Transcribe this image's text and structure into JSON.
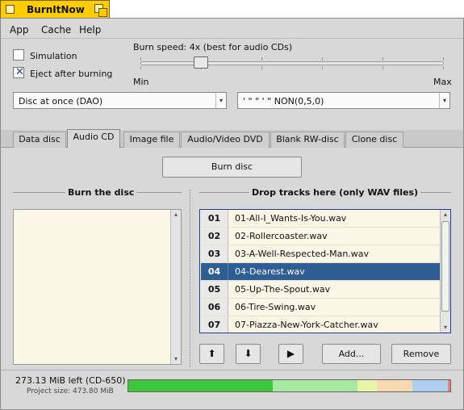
{
  "app": {
    "title": "BurnItNow"
  },
  "menubar": {
    "items": [
      "App",
      "Cache",
      "Help"
    ]
  },
  "options": {
    "simulation_label": "Simulation",
    "simulation_checked": false,
    "eject_label": "Eject after burning",
    "eject_checked": true
  },
  "speed": {
    "label": "Burn speed: 4x (best for audio CDs)",
    "min_label": "Min",
    "max_label": "Max",
    "level": 0.2
  },
  "mode_select": {
    "value": "Disc at once (DAO)"
  },
  "device_select": {
    "value": "' \" \" ' \" NON(0,5,0)"
  },
  "tabs": [
    "Data disc",
    "Audio CD",
    "Image file",
    "Audio/Video DVD",
    "Blank RW-disc",
    "Clone disc"
  ],
  "active_tab": "Audio CD",
  "burn_button": "Burn disc",
  "burn_section": {
    "title": "Burn the disc"
  },
  "tracks_section": {
    "title": "Drop tracks here (only WAV files)"
  },
  "tracks": [
    {
      "num": "01",
      "name": "01-All-I_Wants-Is-You.wav"
    },
    {
      "num": "02",
      "name": "02-Rollercoaster.wav"
    },
    {
      "num": "03",
      "name": "03-A-Well-Respected-Man.wav"
    },
    {
      "num": "04",
      "name": "04-Dearest.wav",
      "selected": true
    },
    {
      "num": "05",
      "name": "05-Up-The-Spout.wav"
    },
    {
      "num": "06",
      "name": "06-Tire-Swing.wav"
    },
    {
      "num": "07",
      "name": "07-Piazza-New-York-Catcher.wav"
    }
  ],
  "track_buttons": {
    "up": "⬆",
    "down": "⬇",
    "play": "▶",
    "add": "Add...",
    "remove": "Remove"
  },
  "status": {
    "left": "273.13 MiB left (CD-650)",
    "project_size": "Project size: 473.80 MiB"
  },
  "capacity_bar": {
    "segments": [
      {
        "fraction": 0.448,
        "color": "#3cc73c"
      },
      {
        "fraction": 0.262,
        "color": "#a8e8a0"
      },
      {
        "fraction": 0.06,
        "color": "#e6f5a8"
      },
      {
        "fraction": 0.11,
        "color": "#f8d8b0"
      },
      {
        "fraction": 0.11,
        "color": "#b0cff0"
      },
      {
        "fraction": 0.01,
        "color": "#f08080"
      }
    ]
  }
}
